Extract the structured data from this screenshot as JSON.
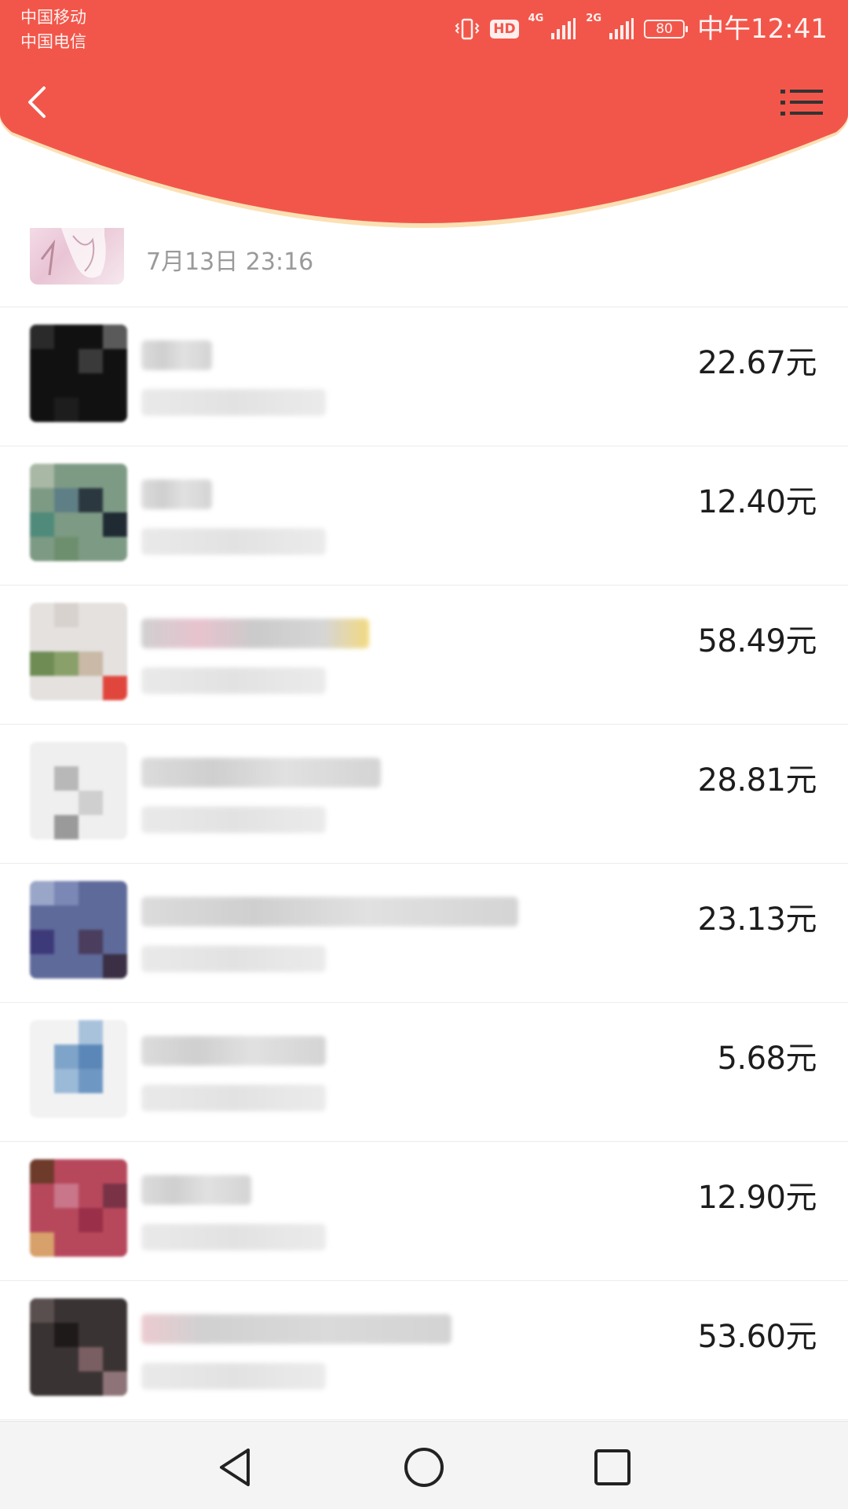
{
  "status_bar": {
    "carrier_1": "中国移动",
    "carrier_2": "中国电信",
    "hd": "HD",
    "net_1": "4G",
    "net_2": "2G",
    "battery": "80",
    "time": "中午12:41"
  },
  "header": {
    "color": "#f2564a",
    "back_icon": "chevron-left-icon",
    "menu_icon": "list-menu-icon"
  },
  "first_row": {
    "time": "7月13日  23:16"
  },
  "transactions": [
    {
      "amount": "22.67元"
    },
    {
      "amount": "12.40元"
    },
    {
      "amount": "58.49元"
    },
    {
      "amount": "28.81元"
    },
    {
      "amount": "23.13元"
    },
    {
      "amount": "5.68元"
    },
    {
      "amount": "12.90元"
    },
    {
      "amount": "53.60元"
    }
  ],
  "nav_bar": {
    "back_icon": "triangle-back-icon",
    "home_icon": "circle-home-icon",
    "recent_icon": "square-recent-icon"
  }
}
